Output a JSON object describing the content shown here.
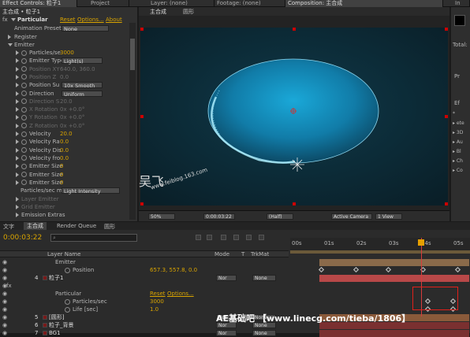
{
  "tabs": {
    "effect_controls": "Effect Controls: 粒子1",
    "project": "Project",
    "layer": "Layer: (none)",
    "footage": "Footage: (none)",
    "composition": "Composition: 主合成",
    "info_short": "In"
  },
  "effect_controls": {
    "path": "主合成 • 粒子1",
    "effect_name": "Particular",
    "reset": "Reset",
    "options": "Options...",
    "about": "About",
    "presets_label": "Animation Presets:",
    "presets_value": "None",
    "register": "Register",
    "emitter": "Emitter",
    "rows": [
      {
        "label": "Particles/se",
        "value": "3000",
        "dim": false
      },
      {
        "label": "Emitter Type",
        "value": "Light(s)",
        "dim": false,
        "dropdown": true
      },
      {
        "label": "Position XY",
        "value": "640.0, 360.0",
        "dim": true
      },
      {
        "label": "Position Z",
        "value": "0.0",
        "dim": true
      },
      {
        "label": "Position Su",
        "value": "10x Smooth",
        "dim": false,
        "dropdown": true
      },
      {
        "label": "Direction",
        "value": "Uniform",
        "dim": false,
        "dropdown": true
      },
      {
        "label": "Direction S",
        "value": "20.0",
        "dim": true
      },
      {
        "label": "X Rotation",
        "value": "0x +0.0°",
        "dim": true
      },
      {
        "label": "Y Rotation",
        "value": "0x +0.0°",
        "dim": true
      },
      {
        "label": "Z Rotation",
        "value": "0x +0.0°",
        "dim": true
      },
      {
        "label": "Velocity",
        "value": "20.0",
        "dim": false
      },
      {
        "label": "Velocity Ra",
        "value": "0.0",
        "dim": false
      },
      {
        "label": "Velocity Dis",
        "value": "0.0",
        "dim": false
      },
      {
        "label": "Velocity fro",
        "value": "0.0",
        "dim": false
      },
      {
        "label": "Emitter Size",
        "value": "0",
        "dim": false
      },
      {
        "label": "Emitter Size",
        "value": "0",
        "dim": false
      },
      {
        "label": "Emitter Size",
        "value": "0",
        "dim": false
      }
    ],
    "particles_per_sec_label": "Particles/sec m",
    "particles_per_sec_value": "Light Intensity",
    "layer_emitter": "Layer Emitter",
    "grid_emitter": "Grid Emitter",
    "emission_extras": "Emission Extras"
  },
  "viewer": {
    "comp_tab": "主合成",
    "icon_tab": "圆形",
    "zoom": "50%",
    "timecode": "0:00:03:22",
    "resolution": "(Half)",
    "camera": "Active Camera",
    "views": "1 View",
    "watermark_cn": "吴飞",
    "watermark_url": "www.feiblog.163.com"
  },
  "right_panel": {
    "total_label": "Total:",
    "pr_label": "Pr",
    "ef_label": "Ef",
    "items": [
      "*",
      "▸ ete",
      "▸ 3D",
      "▸ Au",
      "▸ Bl",
      "▸ Ch",
      "▸ Co"
    ]
  },
  "timeline": {
    "tabs": [
      "文字",
      "主合成",
      "Render Queue",
      "圆形"
    ],
    "timecode": "0:00:03:22",
    "search_placeholder": "",
    "col_layer_name": "Layer Name",
    "col_mode": "Mode",
    "col_t": "T",
    "col_trkmat": "TrkMat",
    "ruler": [
      "00s",
      "01s",
      "02s",
      "03s",
      "04s",
      "05s"
    ],
    "rows": [
      {
        "num": "",
        "name": "Emitter",
        "type": "group"
      },
      {
        "num": "",
        "name": "Position",
        "type": "prop",
        "value": "657.3, 557.8, 0.0"
      },
      {
        "num": "4",
        "name": "粒子1",
        "type": "layer",
        "mode": "Nor",
        "trkmat": "None"
      },
      {
        "num": "",
        "name": "fx",
        "type": "fx"
      },
      {
        "num": "",
        "name": "Particular",
        "type": "effect",
        "reset": "Reset",
        "options": "Options..."
      },
      {
        "num": "",
        "name": "Particles/sec",
        "type": "prop",
        "value": "3000"
      },
      {
        "num": "",
        "name": "Life [sec]",
        "type": "prop",
        "value": "1.0"
      },
      {
        "num": "5",
        "name": "[圆形]",
        "type": "layer",
        "mode": "Nor",
        "trkmat": "None"
      },
      {
        "num": "6",
        "name": "粒子_背景",
        "type": "layer",
        "mode": "Nor",
        "trkmat": "None"
      },
      {
        "num": "7",
        "name": "BG1",
        "type": "layer",
        "mode": "Nor",
        "trkmat": "None"
      }
    ],
    "banner": "AE基础吧 【www.linecg.com/tieba/1806】"
  }
}
